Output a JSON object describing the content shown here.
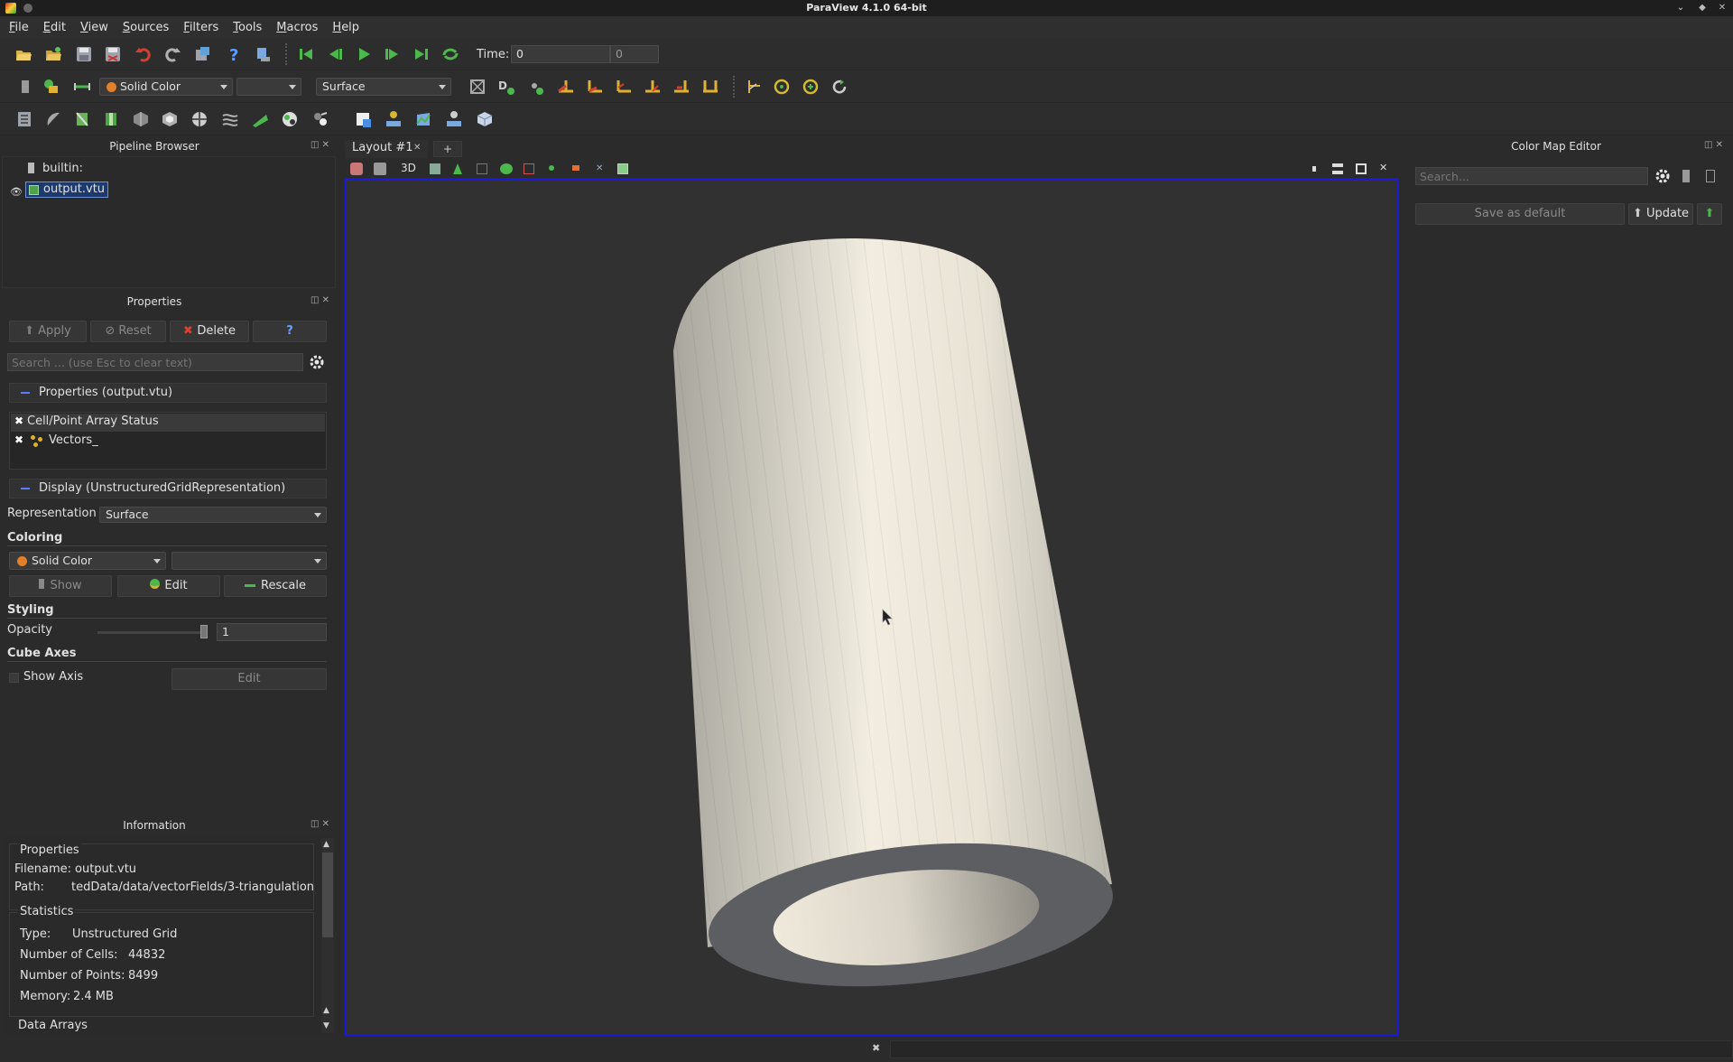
{
  "window": {
    "title": "ParaView 4.1.0 64-bit"
  },
  "menu": [
    "File",
    "Edit",
    "View",
    "Sources",
    "Filters",
    "Tools",
    "Macros",
    "Help"
  ],
  "toolbar": {
    "time_label": "Time:",
    "time_value": "0",
    "time_step": "0",
    "coloring_combo": "Solid Color",
    "representation_combo": "Surface"
  },
  "pipeline_browser": {
    "title": "Pipeline Browser",
    "root": "builtin:",
    "item": "output.vtu"
  },
  "properties": {
    "title": "Properties",
    "apply": "Apply",
    "reset": "Reset",
    "delete": "Delete",
    "help": "?",
    "search_placeholder": "Search ... (use Esc to clear text)",
    "section_props": "Properties (output.vtu)",
    "array_header": "Cell/Point Array Status",
    "array_item": "Vectors_",
    "section_display": "Display (UnstructuredGridRepresentation)",
    "representation_label": "Representation",
    "representation_value": "Surface",
    "coloring_label": "Coloring",
    "coloring_value": "Solid Color",
    "show": "Show",
    "edit": "Edit",
    "rescale": "Rescale",
    "styling_label": "Styling",
    "opacity_label": "Opacity",
    "opacity_value": "1",
    "cube_axes_label": "Cube Axes",
    "show_axis": "Show Axis",
    "cube_edit": "Edit"
  },
  "information": {
    "title": "Information",
    "properties_header": "Properties",
    "filename_label": "Filename:",
    "filename": "output.vtu",
    "path_label": "Path:",
    "path": "tedData/data/vectorFields/3-triangulation",
    "statistics_header": "Statistics",
    "type_label": "Type:",
    "type": "Unstructured Grid",
    "cells_label": "Number of Cells:",
    "cells": "44832",
    "points_label": "Number of Points:",
    "points": "8499",
    "memory_label": "Memory:",
    "memory": "2.4 MB",
    "data_arrays_header": "Data Arrays"
  },
  "layout": {
    "tab": "Layout #1",
    "add_tab": "+",
    "mode_3d": "3D"
  },
  "color_map_editor": {
    "title": "Color Map Editor",
    "search_placeholder": "Search...",
    "save_default": "Save as default",
    "update": "Update"
  },
  "colors": {
    "viewport_border": "#1a1ad8",
    "cylinder_light": "#f2ede0",
    "cylinder_dark": "#a9a69e",
    "cap": "#5d5e62",
    "solid_color_dot": "#e0802a"
  }
}
